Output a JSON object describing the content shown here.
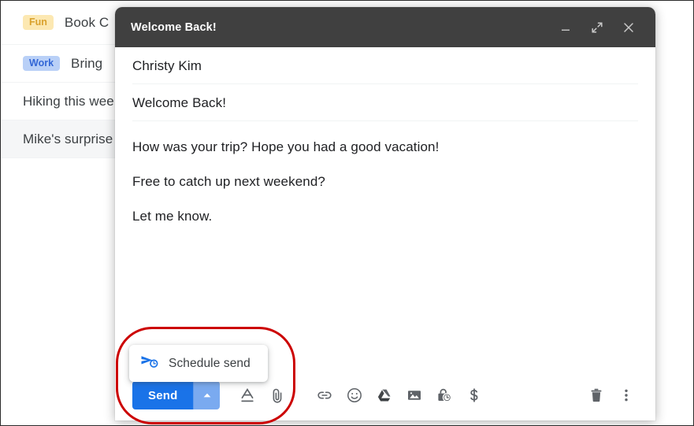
{
  "mail_list": {
    "rows": [
      {
        "chip": "Fun",
        "chip_type": "fun",
        "subject": "Book C",
        "shaded": false
      },
      {
        "chip": "Work",
        "chip_type": "work",
        "subject": "Bring",
        "shaded": false
      },
      {
        "chip": "",
        "chip_type": "",
        "subject": "Hiking this wee",
        "shaded": false
      },
      {
        "chip": "",
        "chip_type": "",
        "subject": "Mike's surprise",
        "shaded": true
      }
    ]
  },
  "compose": {
    "title": "Welcome Back!",
    "window_controls": {
      "minimize": "minimize-icon",
      "expand": "expand-icon",
      "close": "close-icon"
    },
    "recipient": "Christy Kim",
    "subject": "Welcome Back!",
    "body_paragraphs": [
      "How was your trip? Hope you had a good vacation!",
      "Free to catch up next weekend?",
      "Let me know."
    ],
    "footer": {
      "send_label": "Send",
      "send_dropdown_icon": "caret-up-icon",
      "tools": [
        {
          "name": "formatting-options-icon",
          "title": "Formatting options"
        },
        {
          "name": "attach-file-icon",
          "title": "Attach files"
        },
        {
          "name": "insert-link-icon",
          "title": "Insert link"
        },
        {
          "name": "insert-emoji-icon",
          "title": "Insert emoji"
        },
        {
          "name": "insert-drive-icon",
          "title": "Insert files using Drive"
        },
        {
          "name": "insert-photo-icon",
          "title": "Insert photo"
        },
        {
          "name": "confidential-mode-icon",
          "title": "Toggle confidential mode"
        },
        {
          "name": "insert-money-icon",
          "title": "Insert money"
        }
      ],
      "right_tools": [
        {
          "name": "discard-draft-icon",
          "title": "Discard draft"
        },
        {
          "name": "more-options-icon",
          "title": "More options"
        }
      ]
    },
    "schedule_popup": {
      "label": "Schedule send",
      "icon": "schedule-send-icon"
    }
  },
  "colors": {
    "accent_blue": "#1a73e8",
    "send_dropdown_blue": "#7aaaf0",
    "header_gray": "#404040",
    "icon_gray": "#5f6368",
    "annotation_red": "#cc0000",
    "chip_fun_bg": "#fce8b2",
    "chip_fun_text": "#d9a12c",
    "chip_work_bg": "#b9d0f7",
    "chip_work_text": "#3367d6"
  }
}
